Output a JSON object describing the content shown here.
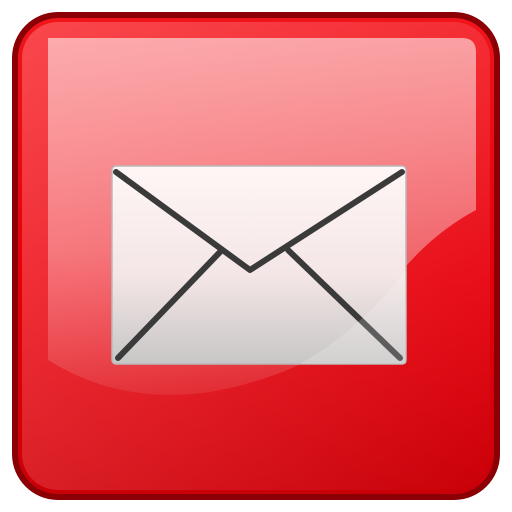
{
  "icon": {
    "name": "mail-icon",
    "glyph": "envelope-icon",
    "colors": {
      "tile_base": "#e4000b",
      "tile_light": "#ff4a4f",
      "tile_dark": "#b30007",
      "border": "#7a0003",
      "envelope_light": "#fff5f5",
      "envelope_shadow": "#c9c9c9",
      "envelope_line": "#333333"
    }
  }
}
